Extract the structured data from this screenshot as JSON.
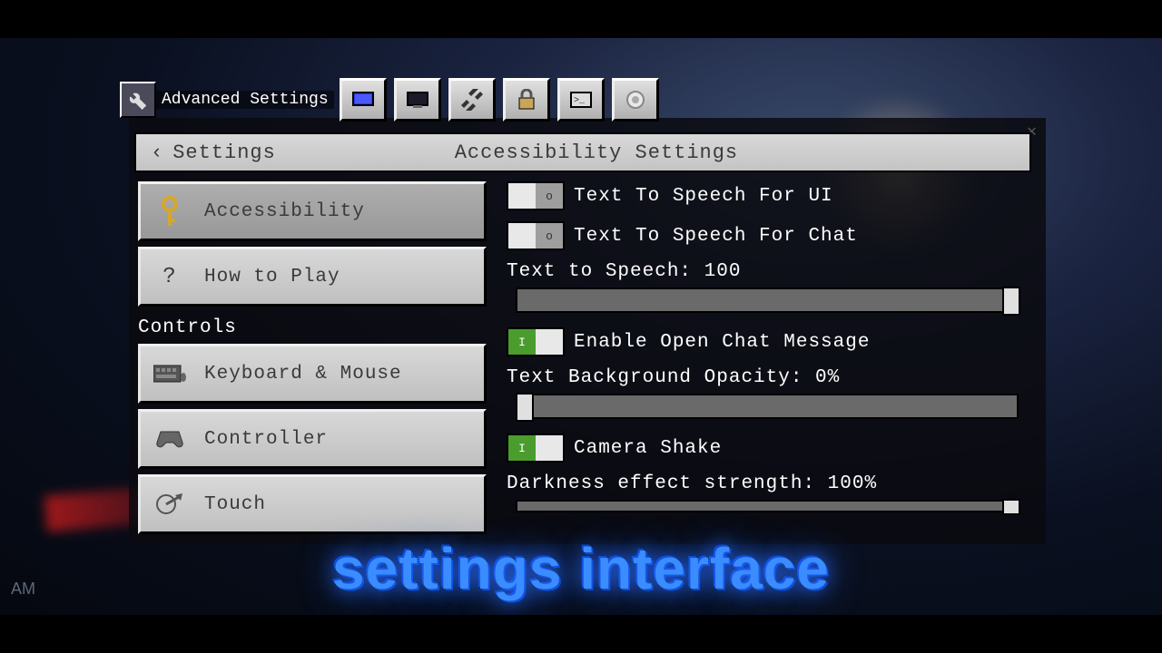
{
  "toolbar": {
    "title": "Advanced Settings",
    "icons": [
      "wrench",
      "display",
      "tools",
      "lock",
      "terminal",
      "gear"
    ]
  },
  "header": {
    "back_label": "Settings",
    "title": "Accessibility Settings"
  },
  "sidebar": {
    "items": [
      {
        "label": "Accessibility",
        "icon": "key",
        "selected": true
      },
      {
        "label": "How to Play",
        "icon": "?",
        "selected": false
      }
    ],
    "sections": [
      {
        "label": "Controls",
        "items": [
          {
            "label": "Keyboard & Mouse",
            "icon": "keyboard"
          },
          {
            "label": "Controller",
            "icon": "gamepad"
          },
          {
            "label": "Touch",
            "icon": "touch"
          }
        ]
      }
    ]
  },
  "content": {
    "toggles": [
      {
        "label": "Text To Speech For UI",
        "on": false
      },
      {
        "label": "Text To Speech For Chat",
        "on": false
      }
    ],
    "slider1": {
      "label": "Text to Speech: 100",
      "value": 100,
      "max": 100
    },
    "toggle3": {
      "label": "Enable Open Chat Message",
      "on": true
    },
    "slider2": {
      "label": "Text Background Opacity: 0%",
      "value": 0,
      "max": 100
    },
    "toggle4": {
      "label": "Camera Shake",
      "on": true
    },
    "slider3": {
      "label": "Darkness effect strength: 100%",
      "value": 100,
      "max": 100
    }
  },
  "caption": "settings interface",
  "watermark": "AM"
}
